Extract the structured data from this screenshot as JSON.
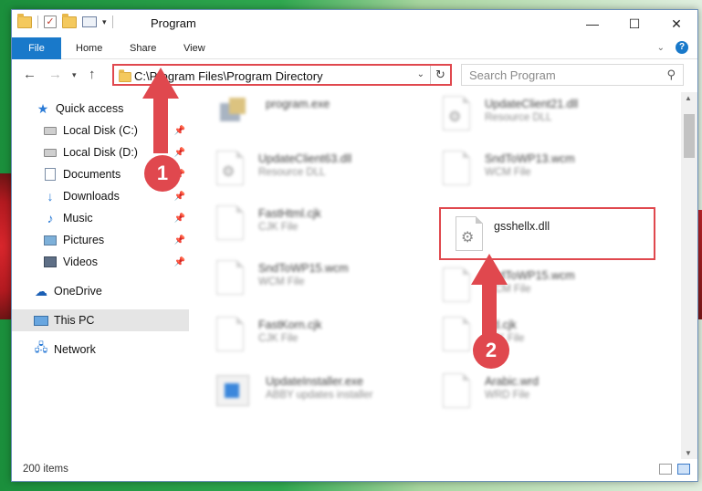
{
  "window": {
    "title": "Program",
    "controls": {
      "minimize": "—",
      "maximize": "☐",
      "close": "✕"
    }
  },
  "ribbon": {
    "tabs": [
      "File",
      "Home",
      "Share",
      "View"
    ]
  },
  "address": {
    "path": "C:\\Program Files\\Program Directory",
    "search_placeholder": "Search Program"
  },
  "sidebar": {
    "quick_access": "Quick access",
    "items": [
      {
        "label": "Local Disk (C:)",
        "icon": "drive-icon",
        "pinned": true
      },
      {
        "label": "Local Disk (D:)",
        "icon": "drive-icon",
        "pinned": true
      },
      {
        "label": "Documents",
        "icon": "documents-icon",
        "pinned": true
      },
      {
        "label": "Downloads",
        "icon": "downloads-icon",
        "pinned": true
      },
      {
        "label": "Music",
        "icon": "music-icon",
        "pinned": true
      },
      {
        "label": "Pictures",
        "icon": "pictures-icon",
        "pinned": true
      },
      {
        "label": "Videos",
        "icon": "videos-icon",
        "pinned": true
      }
    ],
    "onedrive": "OneDrive",
    "this_pc": "This PC",
    "network": "Network"
  },
  "files": [
    {
      "name": "program.exe",
      "type": "",
      "icon": "exe-icon"
    },
    {
      "name": "UpdateClient21.dll",
      "type": "Resource DLL",
      "icon": "dll-icon"
    },
    {
      "name": "UpdateClient63.dll",
      "type": "Resource DLL",
      "icon": "dll-icon"
    },
    {
      "name": "SndToWP13.wcm",
      "type": "WCM File",
      "icon": "file-icon"
    },
    {
      "name": "FastHtml.cjk",
      "type": "CJK File",
      "icon": "file-icon"
    },
    {
      "name": "gsshellx.dll",
      "type": "",
      "icon": "dll-icon",
      "highlighted": true
    },
    {
      "name": "SndToWP15.wcm",
      "type": "WCM File",
      "icon": "file-icon"
    },
    {
      "name": "SndToWP15.wcm",
      "type": "WCM File",
      "icon": "file-icon"
    },
    {
      "name": "FastKorn.cjk",
      "type": "CJK File",
      "icon": "file-icon"
    },
    {
      "name": "cjd.cjk",
      "type": "CJK File",
      "icon": "file-icon"
    },
    {
      "name": "UpdateInstaller.exe",
      "type": "ABBY updates installer",
      "icon": "installer-icon"
    },
    {
      "name": "Arabic.wrd",
      "type": "WRD File",
      "icon": "file-icon"
    }
  ],
  "status": {
    "item_count": "200 items"
  },
  "annotations": {
    "step1": "1",
    "step2": "2",
    "color": "#e0484e"
  }
}
